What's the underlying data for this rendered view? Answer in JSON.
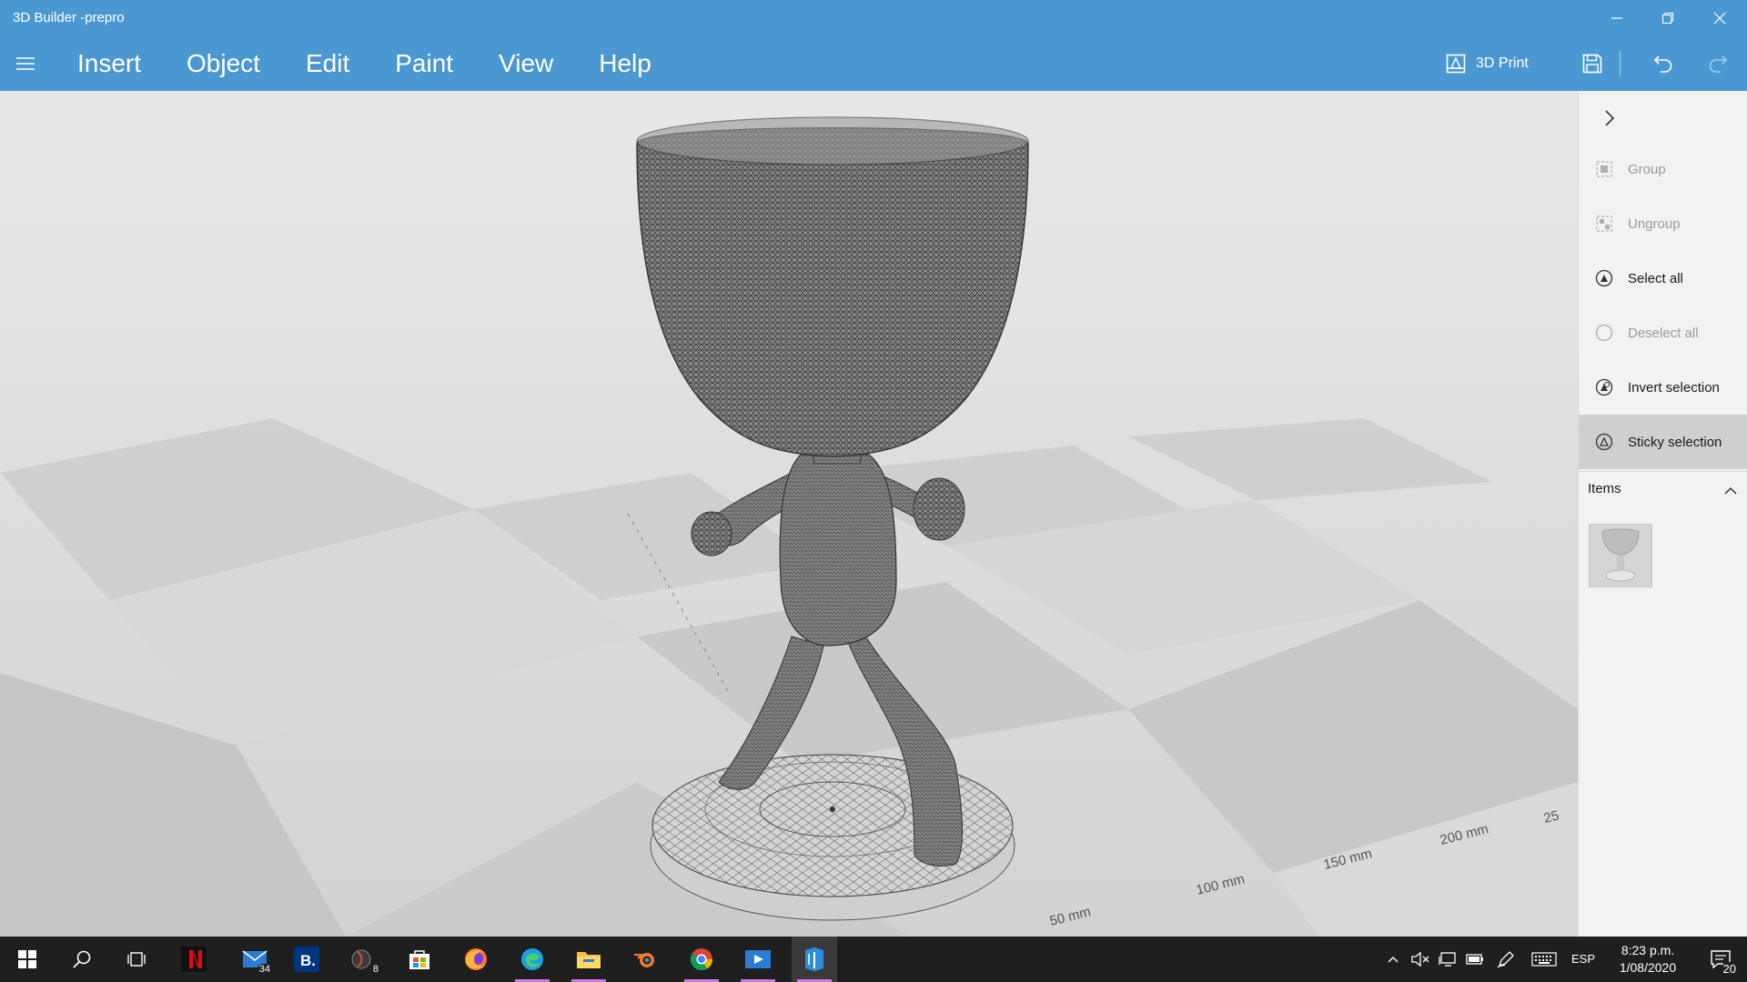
{
  "window": {
    "title": "3D Builder -prepro",
    "controls": {
      "minimize": "minimize-icon",
      "restore": "restore-icon",
      "close": "close-icon"
    }
  },
  "menu": {
    "items": [
      {
        "label": "Insert"
      },
      {
        "label": "Object"
      },
      {
        "label": "Edit"
      },
      {
        "label": "Paint"
      },
      {
        "label": "View"
      },
      {
        "label": "Help"
      }
    ],
    "print_label": "3D Print"
  },
  "viewport": {
    "ruler_labels": [
      "50 mm",
      "100 mm",
      "150 mm",
      "200 mm",
      "25"
    ]
  },
  "panel": {
    "commands": [
      {
        "label": "Group",
        "enabled": false
      },
      {
        "label": "Ungroup",
        "enabled": false
      },
      {
        "label": "Select all",
        "enabled": true
      },
      {
        "label": "Deselect all",
        "enabled": false
      },
      {
        "label": "Invert selection",
        "enabled": true
      },
      {
        "label": "Sticky selection",
        "enabled": true,
        "active": true
      }
    ],
    "items_title": "Items"
  },
  "taskbar": {
    "mail_badge": "34",
    "app8_badge": "8",
    "language": "ESP",
    "time": "8:23 p.m.",
    "date": "1/08/2020",
    "notifications": "20"
  },
  "colors": {
    "accent": "#4b97d1",
    "taskbar": "#1f1f1f",
    "running_indicator": "#c87be6"
  }
}
